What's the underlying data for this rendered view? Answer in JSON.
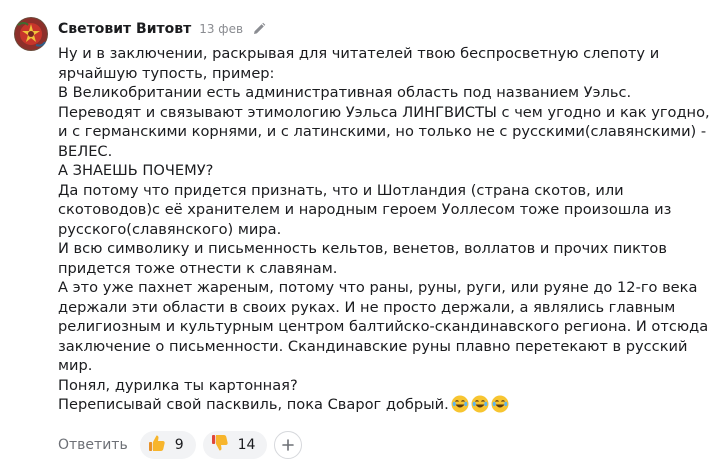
{
  "comment": {
    "author": "Световит Витовт",
    "date": "13 фев",
    "lines": [
      "Ну и в заключении, раскрывая для читателей твою беспросветную слепоту и",
      "ярчайшую тупость, пример:",
      "В Великобритании есть административная область под названием Уэльс.",
      "Переводят и связывают этимологию Уэльса ЛИНГВИСТЫ с чем угодно и как угодно,",
      "и с германскими корнями, и с латинскими, но только не с русскими(славянскими) -",
      "ВЕЛЕС.",
      "А ЗНАЕШЬ ПОЧЕМУ?",
      "Да потому что придется признать, что и Шотландия (страна скотов, или",
      "скотоводов)с её хранителем и народным героем Уоллесом тоже произошла из",
      "русского(славянского) мира.",
      "И всю символику и письменность кельтов, венетов, воллатов и прочих пиктов",
      "придется тоже отнести к славянам.",
      "А это уже пахнет жареным, потому что раны, руны, руги, или руяне до 12-го века",
      "держали эти области в своих руках. И не просто держали, а являлись главным",
      "религиозным и культурным центром балтийско-скандинавского региона. И отсюда",
      "заключение о письменности. Скандинавские руны плавно перетекают в русский",
      "мир.",
      "Понял, дурилка ты картонная?",
      "Переписывай свой пасквиль, пока Сварог добрый."
    ],
    "trailing_emoji": [
      "grinning-tears-emoji",
      "grinning-tears-emoji",
      "grinning-tears-emoji"
    ]
  },
  "actions": {
    "reply_label": "Ответить",
    "likes": "9",
    "dislikes": "14"
  },
  "icons": {
    "edit": "pencil-icon",
    "like": "thumbs-up-icon",
    "dislike": "thumbs-down-icon",
    "add_reaction": "plus-icon"
  },
  "colors": {
    "text": "#1b1c1f",
    "muted": "#8a8c91",
    "pill_bg": "#f2f3f5",
    "reaction_yellow": "#f7b52c",
    "reaction_red": "#e0473a"
  }
}
